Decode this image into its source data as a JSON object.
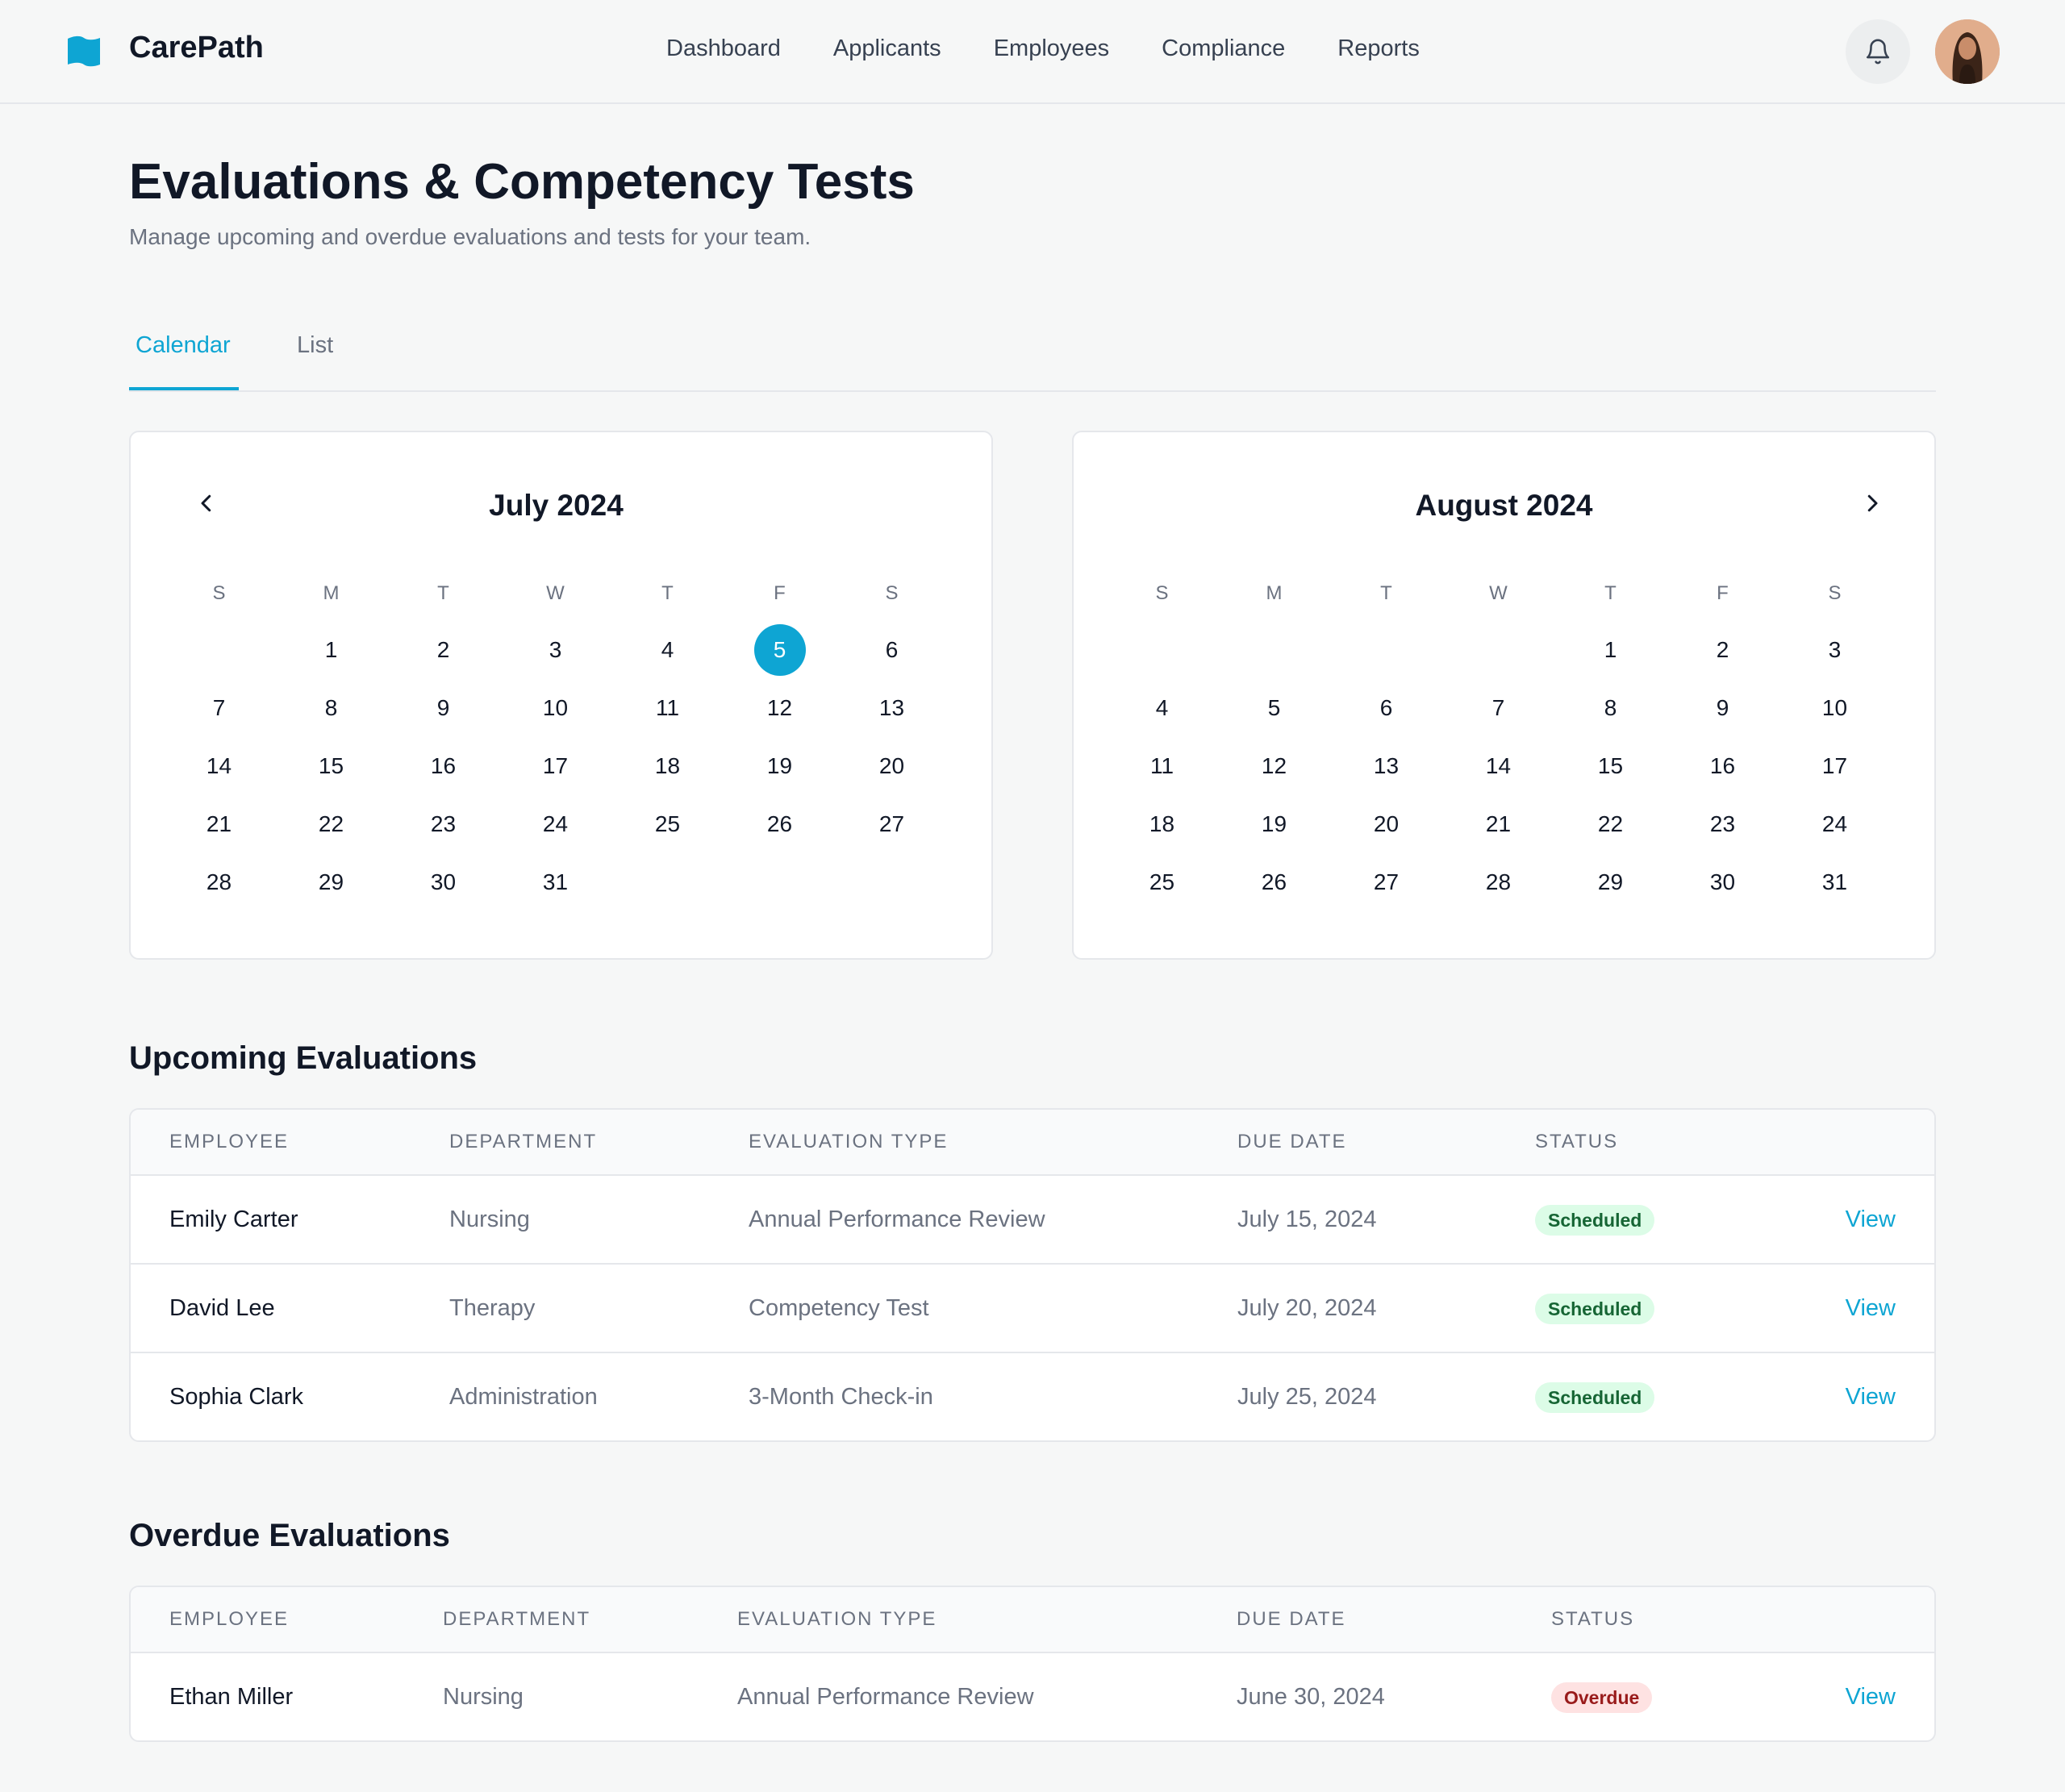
{
  "app": {
    "brand": "CarePath",
    "accent_color": "#0ea5d3",
    "logo_icon": "flag-icon"
  },
  "nav": [
    "Dashboard",
    "Applicants",
    "Employees",
    "Compliance",
    "Reports"
  ],
  "header": {
    "bell_icon": "bell-icon",
    "avatar": "user-avatar"
  },
  "page": {
    "title": "Evaluations & Competency Tests",
    "subtitle": "Manage upcoming and overdue evaluations and tests for your team."
  },
  "tabs": [
    {
      "label": "Calendar",
      "active": true
    },
    {
      "label": "List",
      "active": false
    }
  ],
  "calendars": [
    {
      "title": "July 2024",
      "weekdays": [
        "S",
        "M",
        "T",
        "W",
        "T",
        "F",
        "S"
      ],
      "first_weekday_index": 1,
      "days": 31,
      "selected_day": 5,
      "nav": "chevron-left-icon"
    },
    {
      "title": "August 2024",
      "weekdays": [
        "S",
        "M",
        "T",
        "W",
        "T",
        "F",
        "S"
      ],
      "first_weekday_index": 4,
      "days": 31,
      "selected_day": null,
      "nav": "chevron-right-icon"
    }
  ],
  "upcoming": {
    "title": "Upcoming Evaluations",
    "columns": [
      "EMPLOYEE",
      "DEPARTMENT",
      "EVALUATION TYPE",
      "DUE DATE",
      "STATUS"
    ],
    "rows": [
      {
        "employee": "Emily Carter",
        "department": "Nursing",
        "type": "Annual Performance Review",
        "due": "July 15, 2024",
        "status": "Scheduled",
        "action": "View"
      },
      {
        "employee": "David Lee",
        "department": "Therapy",
        "type": "Competency Test",
        "due": "July 20, 2024",
        "status": "Scheduled",
        "action": "View"
      },
      {
        "employee": "Sophia Clark",
        "department": "Administration",
        "type": "3-Month Check-in",
        "due": "July 25, 2024",
        "status": "Scheduled",
        "action": "View"
      }
    ]
  },
  "overdue": {
    "title": "Overdue Evaluations",
    "columns": [
      "EMPLOYEE",
      "DEPARTMENT",
      "EVALUATION TYPE",
      "DUE DATE",
      "STATUS"
    ],
    "rows": [
      {
        "employee": "Ethan Miller",
        "department": "Nursing",
        "type": "Annual Performance Review",
        "due": "June 30, 2024",
        "status": "Overdue",
        "action": "View"
      }
    ]
  },
  "colors": {
    "scheduled_bg": "#dcfce7",
    "scheduled_text": "#166534",
    "overdue_bg": "#fee2e2",
    "overdue_text": "#991b1b"
  }
}
